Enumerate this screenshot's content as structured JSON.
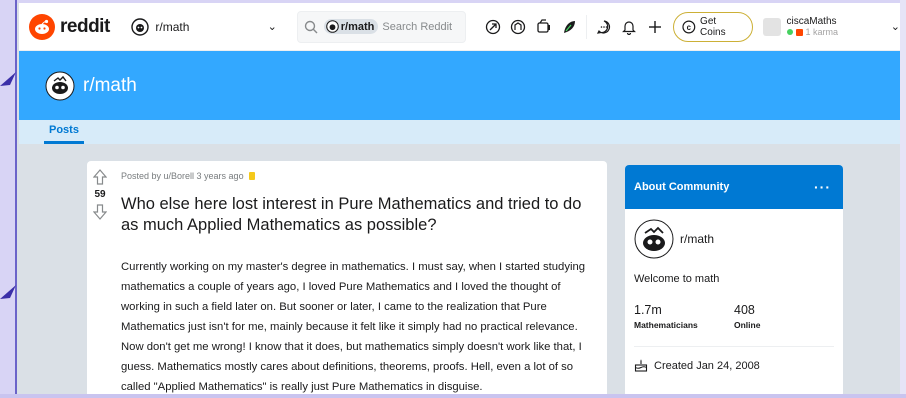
{
  "header": {
    "logo_text": "reddit",
    "community": "r/math",
    "search_chip": "r/math",
    "search_placeholder": "Search Reddit",
    "coins_label": "Get Coins",
    "username": "ciscaMaths",
    "karma": "1 karma",
    "icons": [
      "popular-icon",
      "coins-icon",
      "video-icon",
      "moderation-icon",
      "chat-icon",
      "notification-icon",
      "plus-icon"
    ]
  },
  "banner": {
    "title": "r/math"
  },
  "tabs": {
    "posts": "Posts"
  },
  "post": {
    "meta": "Posted by u/Borell 3 years ago",
    "votes": "59",
    "title": "Who else here lost interest in Pure Mathematics and tried to do as much Applied Mathematics as possible?",
    "body": "Currently working on my master's degree in mathematics. I must say, when I started studying mathematics a couple of years ago, I loved Pure Mathematics and I loved the thought of working in such a field later on. But sooner or later, I came to the realization that Pure Mathematics just isn't for me, mainly because it felt like it simply had no practical relevance. Now don't get me wrong! I know that it does, but mathematics simply doesn't work like that, I guess. Mathematics mostly cares about definitions, theorems, proofs. Hell, even a lot of so called \"Applied Mathematics\" is really just Pure Mathematics in disguise."
  },
  "about": {
    "heading": "About Community",
    "menu": "···",
    "community_name": "r/math",
    "welcome": "Welcome to math",
    "members_value": "1.7m",
    "members_label": "Mathematicians",
    "online_value": "408",
    "online_label": "Online",
    "created": "Created Jan 24, 2008"
  },
  "colors": {
    "brand": "#ff4500",
    "banner": "#33a8ff",
    "accent": "#0079d3",
    "tabs_bg": "#d7ebf9",
    "page_bg": "#dae0e6"
  }
}
